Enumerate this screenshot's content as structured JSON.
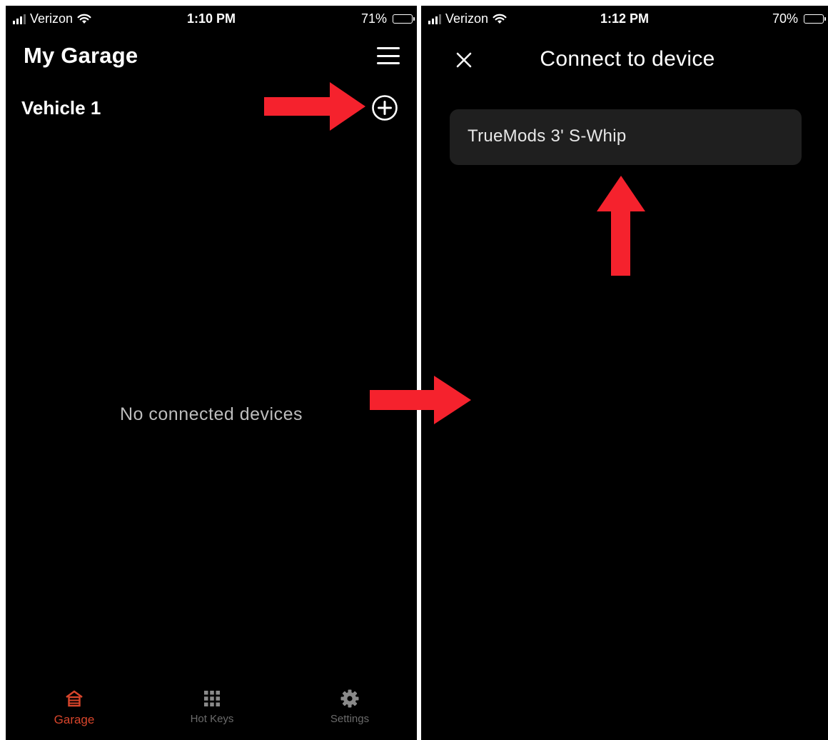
{
  "left_screen": {
    "status_bar": {
      "carrier": "Verizon",
      "time": "1:10 PM",
      "battery_percent": "71%",
      "battery_level": 0.71
    },
    "title": "My Garage",
    "vehicle_name": "Vehicle 1",
    "empty_message": "No connected devices",
    "tabs": [
      {
        "label": "Garage",
        "icon": "garage-icon",
        "active": true
      },
      {
        "label": "Hot Keys",
        "icon": "keypad-grid-icon",
        "active": false
      },
      {
        "label": "Settings",
        "icon": "gear-icon",
        "active": false
      }
    ]
  },
  "right_screen": {
    "status_bar": {
      "carrier": "Verizon",
      "time": "1:12 PM",
      "battery_percent": "70%",
      "battery_level": 0.7
    },
    "title": "Connect to device",
    "devices": [
      {
        "name": "TrueMods 3' S-Whip"
      }
    ]
  },
  "colors": {
    "background": "#000000",
    "accent": "#d8452b",
    "annotation_arrow": "#f5222d",
    "inactive_tab": "#6b6b6b",
    "device_row": "#1f1f1f"
  }
}
